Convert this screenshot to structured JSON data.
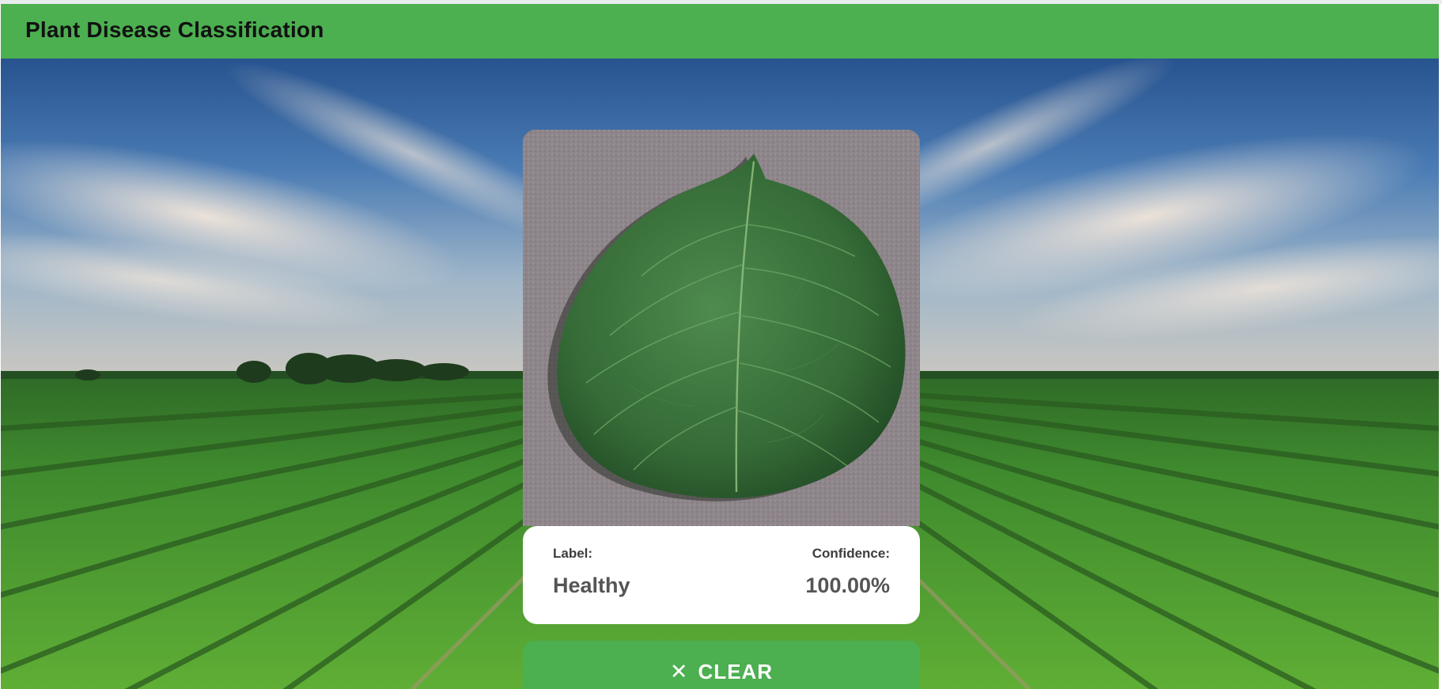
{
  "app": {
    "title": "Plant Disease Classification",
    "accent_color": "#4caf50"
  },
  "background": {
    "description_icon": "farm-field-background"
  },
  "upload": {
    "image_icon": "leaf-photo"
  },
  "result": {
    "label_caption": "Label:",
    "label_value": "Healthy",
    "confidence_caption": "Confidence:",
    "confidence_value": "100.00%"
  },
  "actions": {
    "clear_label": "CLEAR",
    "clear_icon": "close-icon",
    "clear_glyph": "✕"
  }
}
